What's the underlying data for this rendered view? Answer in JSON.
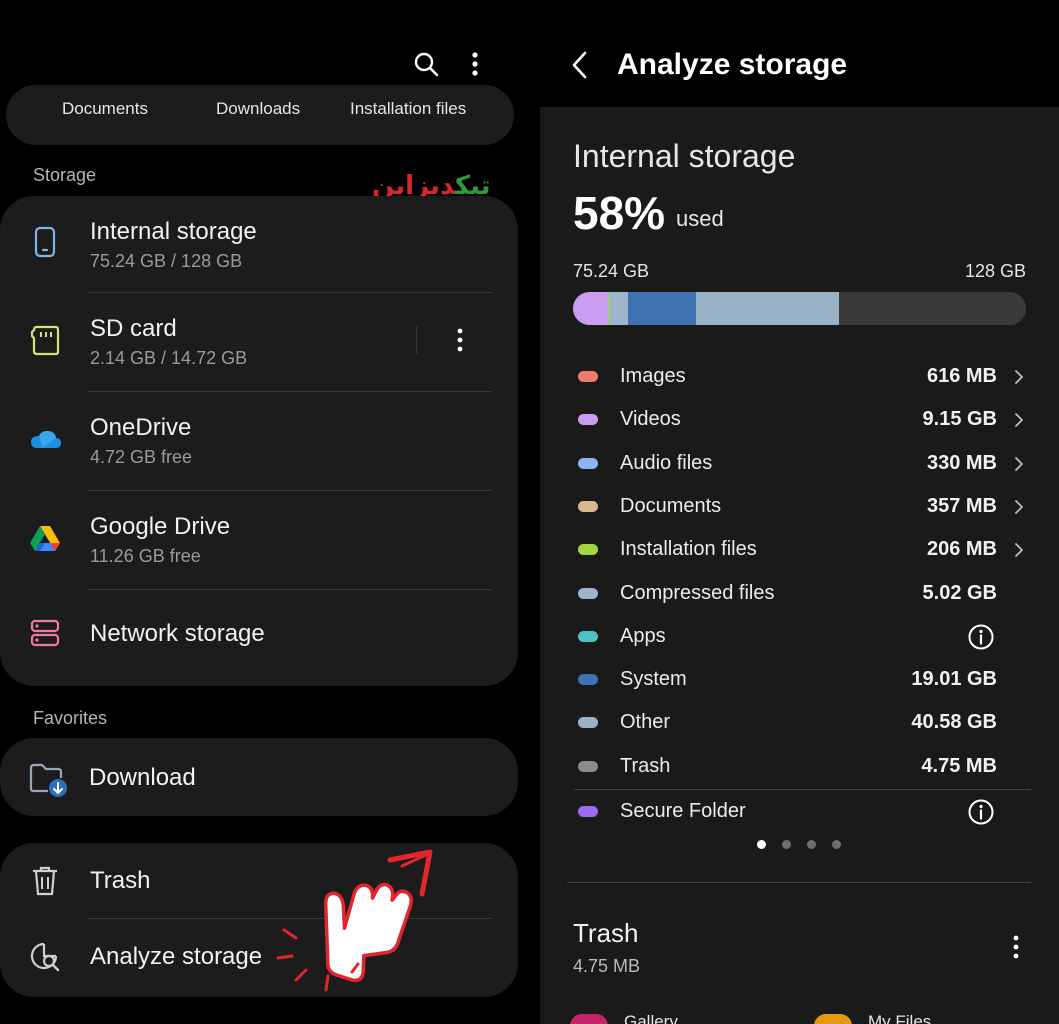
{
  "left": {
    "quick_tabs": [
      "Documents",
      "Downloads",
      "Installation files"
    ],
    "storage_label": "Storage",
    "watermark": "ديزاينتيك",
    "storage_items": [
      {
        "title": "Internal storage",
        "subtitle": "75.24 GB / 128 GB",
        "icon": "phone-icon"
      },
      {
        "title": "SD card",
        "subtitle": "2.14 GB / 14.72 GB",
        "icon": "sd-card-icon"
      },
      {
        "title": "OneDrive",
        "subtitle": "4.72 GB free",
        "icon": "onedrive-icon"
      },
      {
        "title": "Google Drive",
        "subtitle": "11.26 GB free",
        "icon": "google-drive-icon"
      },
      {
        "title": "Network storage",
        "subtitle": "",
        "icon": "network-storage-icon"
      }
    ],
    "favorites_label": "Favorites",
    "favorites": [
      {
        "title": "Download",
        "icon": "download-folder-icon"
      }
    ],
    "tools": [
      {
        "title": "Trash",
        "icon": "trash-icon"
      },
      {
        "title": "Analyze storage",
        "icon": "analyze-storage-icon"
      }
    ]
  },
  "right": {
    "title": "Analyze storage",
    "storage_name": "Internal storage",
    "percent": "58%",
    "used_label": "used",
    "used_amount": "75.24 GB",
    "total_amount": "128 GB",
    "categories": [
      {
        "name": "Images",
        "size": "616 MB",
        "color": "#f07a69",
        "chevron": true
      },
      {
        "name": "Videos",
        "size": "9.15 GB",
        "color": "#c99ef0",
        "chevron": true
      },
      {
        "name": "Audio files",
        "size": "330 MB",
        "color": "#8ab4f4",
        "chevron": true
      },
      {
        "name": "Documents",
        "size": "357 MB",
        "color": "#d7b98e",
        "chevron": true
      },
      {
        "name": "Installation files",
        "size": "206 MB",
        "color": "#a5d63f",
        "chevron": true
      },
      {
        "name": "Compressed files",
        "size": "5.02 GB",
        "color": "#9fb3cc",
        "chevron": false
      },
      {
        "name": "Apps",
        "size": "",
        "color": "#4fc0c0",
        "info": true
      },
      {
        "name": "System",
        "size": "19.01 GB",
        "color": "#3f72b3",
        "chevron": false
      },
      {
        "name": "Other",
        "size": "40.58 GB",
        "color": "#9ab2c6",
        "chevron": false
      },
      {
        "name": "Trash",
        "size": "4.75 MB",
        "color": "#8a8a8f",
        "chevron": false
      },
      {
        "name": "Secure Folder",
        "size": "",
        "color": "#9b6cf0",
        "info": true
      }
    ],
    "bar_segments": [
      {
        "label": "Videos",
        "color": "#c99ef0",
        "fraction": 0.077
      },
      {
        "label": "Installation files",
        "color": "#a5d63f",
        "fraction": 0.003
      },
      {
        "label": "Compressed files",
        "color": "#9fb3cc",
        "fraction": 0.042
      },
      {
        "label": "System",
        "color": "#3f72b3",
        "fraction": 0.149
      },
      {
        "label": "Other",
        "color": "#9ab2c6",
        "fraction": 0.317
      }
    ],
    "pager_dots": 4,
    "pager_active": 0,
    "trash_section": {
      "title": "Trash",
      "size": "4.75 MB"
    },
    "trash_apps": [
      "Gallery",
      "My Files"
    ]
  }
}
